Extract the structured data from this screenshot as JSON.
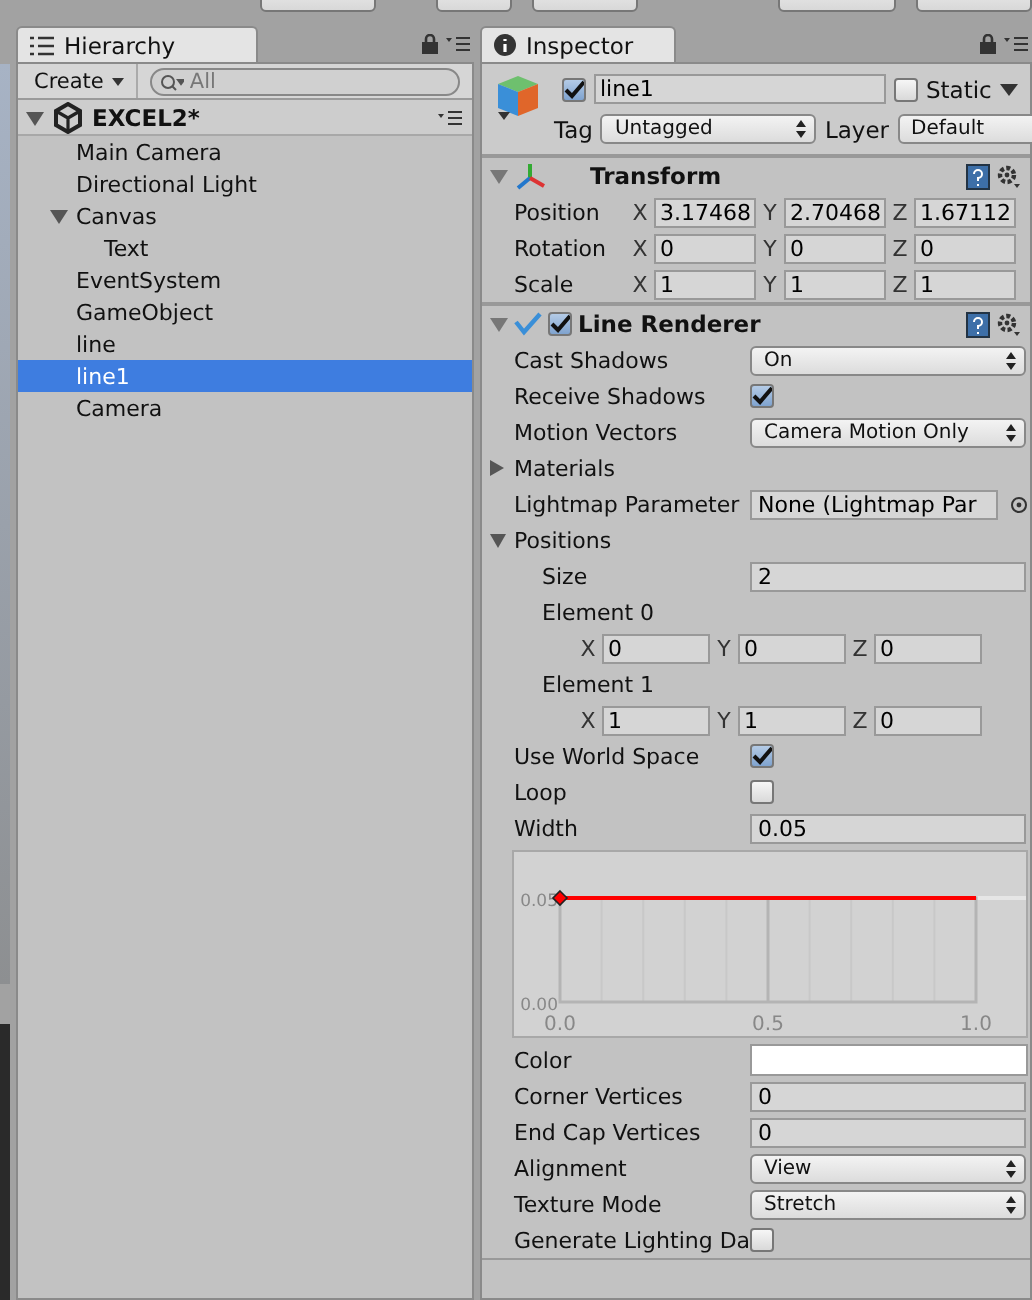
{
  "hierarchy": {
    "tab": "Hierarchy",
    "create": "Create",
    "search": {
      "placeholder": "All"
    },
    "scene": {
      "name": "EXCEL2*",
      "expanded": true
    },
    "items": [
      {
        "label": "Main Camera",
        "selected": false
      },
      {
        "label": "Directional Light",
        "selected": false
      },
      {
        "label": "Canvas",
        "selected": false,
        "expanded": true,
        "children": [
          {
            "label": "Text",
            "selected": false
          }
        ]
      },
      {
        "label": "EventSystem",
        "selected": false
      },
      {
        "label": "GameObject",
        "selected": false
      },
      {
        "label": "line",
        "selected": false
      },
      {
        "label": "line1",
        "selected": true
      },
      {
        "label": "Camera",
        "selected": false
      }
    ]
  },
  "inspector": {
    "tab": "Inspector",
    "object": {
      "active": true,
      "name": "line1",
      "static": false,
      "static_label": "Static",
      "tag_label": "Tag",
      "tag": "Untagged",
      "layer_label": "Layer",
      "layer": "Default"
    },
    "transform": {
      "title": "Transform",
      "expanded": true,
      "rows": [
        {
          "label": "Position",
          "values": [
            {
              "axis": "X",
              "value": "3.17468"
            },
            {
              "axis": "Y",
              "value": "2.70468"
            },
            {
              "axis": "Z",
              "value": "1.67112"
            }
          ]
        },
        {
          "label": "Rotation",
          "values": [
            {
              "axis": "X",
              "value": "0"
            },
            {
              "axis": "Y",
              "value": "0"
            },
            {
              "axis": "Z",
              "value": "0"
            }
          ]
        },
        {
          "label": "Scale",
          "values": [
            {
              "axis": "X",
              "value": "1"
            },
            {
              "axis": "Y",
              "value": "1"
            },
            {
              "axis": "Z",
              "value": "1"
            }
          ]
        }
      ]
    },
    "line_renderer": {
      "title": "Line Renderer",
      "enabled": true,
      "expanded": true,
      "properties": [
        {
          "kind": "dropdown",
          "label": "Cast Shadows",
          "value": "On"
        },
        {
          "kind": "checkbox",
          "label": "Receive Shadows",
          "checked": true
        },
        {
          "kind": "dropdown",
          "label": "Motion Vectors",
          "value": "Camera Motion Only"
        },
        {
          "kind": "foldout",
          "label": "Materials",
          "expanded": false
        },
        {
          "kind": "object",
          "label": "Lightmap Parameter",
          "value": "None (Lightmap Par"
        },
        {
          "kind": "foldout",
          "label": "Positions",
          "expanded": true,
          "children": [
            {
              "kind": "field",
              "label": "Size",
              "value": "2"
            },
            {
              "kind": "heading",
              "label": "Element 0"
            },
            {
              "kind": "vector",
              "values": [
                {
                  "axis": "X",
                  "value": "0"
                },
                {
                  "axis": "Y",
                  "value": "0"
                },
                {
                  "axis": "Z",
                  "value": "0"
                }
              ]
            },
            {
              "kind": "heading",
              "label": "Element 1"
            },
            {
              "kind": "vector",
              "values": [
                {
                  "axis": "X",
                  "value": "1"
                },
                {
                  "axis": "Y",
                  "value": "1"
                },
                {
                  "axis": "Z",
                  "value": "0"
                }
              ]
            }
          ]
        },
        {
          "kind": "checkbox",
          "label": "Use World Space",
          "checked": true
        },
        {
          "kind": "checkbox",
          "label": "Loop",
          "checked": false
        },
        {
          "kind": "field",
          "label": "Width",
          "value": "0.05"
        },
        {
          "kind": "curve",
          "chart_data": {
            "type": "line",
            "x": [
              0,
              1
            ],
            "series": [
              {
                "color": "#ff0000",
                "values": [
                  0.05,
                  0.05
                ]
              }
            ],
            "xlim": [
              0,
              1
            ],
            "ylim": [
              0,
              0.05
            ],
            "xticks": [
              {
                "value": 0,
                "label": "0.0"
              },
              {
                "value": 0.5,
                "label": "0.5"
              },
              {
                "value": 1,
                "label": "1.0"
              }
            ],
            "yticks": [
              {
                "value": 0,
                "label": "0.00"
              },
              {
                "value": 0.05,
                "label": "0.05"
              }
            ]
          }
        },
        {
          "kind": "color",
          "label": "Color",
          "color": "#ffffff"
        },
        {
          "kind": "field",
          "label": "Corner Vertices",
          "value": "0"
        },
        {
          "kind": "field",
          "label": "End Cap Vertices",
          "value": "0"
        },
        {
          "kind": "dropdown",
          "label": "Alignment",
          "value": "View"
        },
        {
          "kind": "dropdown",
          "label": "Texture Mode",
          "value": "Stretch"
        },
        {
          "kind": "checkbox",
          "label": "Generate Lighting Da",
          "checked": false
        }
      ]
    }
  }
}
